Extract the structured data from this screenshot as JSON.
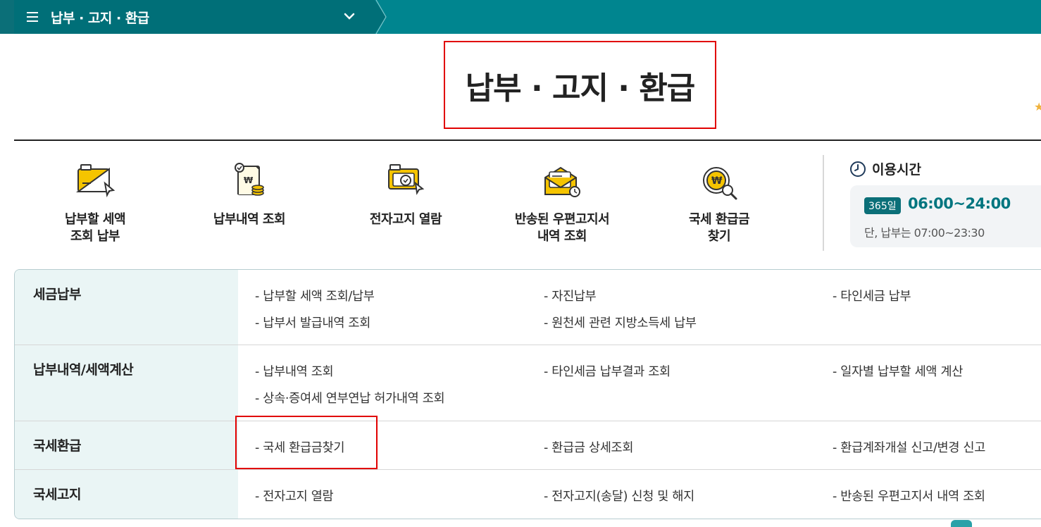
{
  "topbar": {
    "menu_title": "납부 · 고지 · 환급"
  },
  "page": {
    "title": "납부 · 고지 · 환급"
  },
  "quick_menu": [
    {
      "label": "납부할 세액\n조회 납부",
      "icon": "tax-payment-icon"
    },
    {
      "label": "납부내역 조회",
      "icon": "payment-history-icon"
    },
    {
      "label": "전자고지 열람",
      "icon": "e-notice-icon"
    },
    {
      "label": "반송된 우편고지서\n내역 조회",
      "icon": "returned-mail-icon"
    },
    {
      "label": "국세 환급금\n찾기",
      "icon": "refund-search-icon"
    }
  ],
  "hours": {
    "title": "이용시간",
    "badge": "365일",
    "time": "06:00~24:00",
    "note": "단, 납부는 07:00~23:30"
  },
  "categories": [
    {
      "name": "세금납부",
      "links": [
        "납부할 세액 조회/납부",
        "자진납부",
        "타인세금 납부",
        "납부서 발급내역 조회",
        "원천세 관련 지방소득세 납부"
      ]
    },
    {
      "name": "납부내역/세액계산",
      "links": [
        "납부내역 조회",
        "타인세금 납부결과 조회",
        "일자별 납부할 세액 계산",
        "상속·증여세 연부연납 허가내역 조회"
      ]
    },
    {
      "name": "국세환급",
      "links": [
        "국세 환급금찾기",
        "환급금 상세조회",
        "환급계좌개설 신고/변경 신고"
      ]
    },
    {
      "name": "국세고지",
      "links": [
        "전자고지 열람",
        "전자고지(송달) 신청 및 해지",
        "반송된 우편고지서 내역 조회"
      ]
    }
  ],
  "colors": {
    "brand": "#00858f",
    "brand_dark": "#006f78",
    "highlight": "#e10000",
    "accent_yellow": "#f5c400"
  }
}
